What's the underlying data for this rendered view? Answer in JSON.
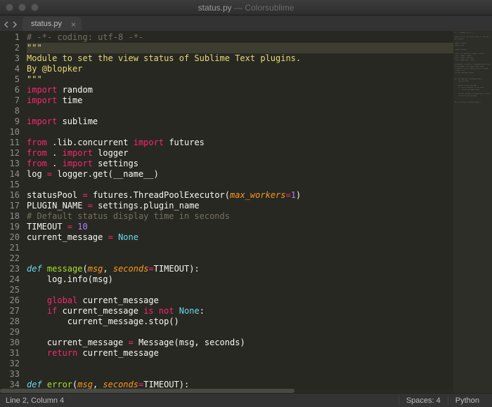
{
  "window": {
    "filename": "status.py",
    "app": "Colorsublime"
  },
  "tab": {
    "label": "status.py"
  },
  "statusbar": {
    "position": "Line 2, Column 4",
    "spaces": "Spaces: 4",
    "syntax": "Python"
  },
  "line_start": 1,
  "line_end": 34,
  "cursor_line": 2,
  "code": [
    {
      "t": [
        [
          "c-cmt",
          "# -*- coding: utf-8 -*-"
        ]
      ]
    },
    {
      "t": [
        [
          "c-str",
          "\"\"\""
        ]
      ]
    },
    {
      "t": [
        [
          "c-str",
          "Module to set the view status of Sublime Text plugins."
        ]
      ]
    },
    {
      "t": [
        [
          "c-str",
          "By @blopker"
        ]
      ]
    },
    {
      "t": [
        [
          "c-str",
          "\"\"\""
        ]
      ]
    },
    {
      "t": [
        [
          "c-kw",
          "import"
        ],
        [
          "",
          " random"
        ]
      ]
    },
    {
      "t": [
        [
          "c-kw",
          "import"
        ],
        [
          "",
          " time"
        ]
      ]
    },
    {
      "t": []
    },
    {
      "t": [
        [
          "c-kw",
          "import"
        ],
        [
          "",
          " sublime"
        ]
      ]
    },
    {
      "t": []
    },
    {
      "t": [
        [
          "c-kw",
          "from"
        ],
        [
          "",
          " .lib.concurrent "
        ],
        [
          "c-kw",
          "import"
        ],
        [
          "",
          " futures"
        ]
      ]
    },
    {
      "t": [
        [
          "c-kw",
          "from"
        ],
        [
          "",
          " . "
        ],
        [
          "c-kw",
          "import"
        ],
        [
          "",
          " logger"
        ]
      ]
    },
    {
      "t": [
        [
          "c-kw",
          "from"
        ],
        [
          "",
          " . "
        ],
        [
          "c-kw",
          "import"
        ],
        [
          "",
          " settings"
        ]
      ]
    },
    {
      "t": [
        [
          "",
          "log "
        ],
        [
          "c-op",
          "="
        ],
        [
          "",
          " logger.get(__name__)"
        ]
      ]
    },
    {
      "t": []
    },
    {
      "t": [
        [
          "",
          "statusPool "
        ],
        [
          "c-op",
          "="
        ],
        [
          "",
          " futures.ThreadPoolExecutor("
        ],
        [
          "c-arg",
          "max_workers"
        ],
        [
          "c-op",
          "="
        ],
        [
          "c-num",
          "1"
        ],
        [
          "",
          ")"
        ]
      ]
    },
    {
      "t": [
        [
          "",
          "PLUGIN_NAME "
        ],
        [
          "c-op",
          "="
        ],
        [
          "",
          " settings.plugin_name"
        ]
      ]
    },
    {
      "t": [
        [
          "c-cmt",
          "# Default status display time in seconds"
        ]
      ]
    },
    {
      "t": [
        [
          "",
          "TIMEOUT "
        ],
        [
          "c-op",
          "="
        ],
        [
          "",
          " "
        ],
        [
          "c-num",
          "10"
        ]
      ]
    },
    {
      "t": [
        [
          "",
          "current_message "
        ],
        [
          "c-op",
          "="
        ],
        [
          "",
          " "
        ],
        [
          "c-spc",
          "None"
        ]
      ]
    },
    {
      "t": []
    },
    {
      "t": []
    },
    {
      "t": [
        [
          "c-def",
          "def "
        ],
        [
          "c-fn",
          "message"
        ],
        [
          "",
          "("
        ],
        [
          "c-arg",
          "msg"
        ],
        [
          "",
          ", "
        ],
        [
          "c-arg",
          "seconds"
        ],
        [
          "c-op",
          "="
        ],
        [
          "",
          "TIMEOUT):"
        ]
      ]
    },
    {
      "t": [
        [
          "",
          "    log.info(msg)"
        ]
      ]
    },
    {
      "t": []
    },
    {
      "t": [
        [
          "",
          "    "
        ],
        [
          "c-kw",
          "global"
        ],
        [
          "",
          " current_message"
        ]
      ]
    },
    {
      "t": [
        [
          "",
          "    "
        ],
        [
          "c-kw",
          "if"
        ],
        [
          "",
          " current_message "
        ],
        [
          "c-kw",
          "is"
        ],
        [
          "",
          " "
        ],
        [
          "c-kw",
          "not"
        ],
        [
          "",
          " "
        ],
        [
          "c-spc",
          "None"
        ],
        [
          "",
          ":"
        ]
      ]
    },
    {
      "t": [
        [
          "",
          "        current_message.stop()"
        ]
      ]
    },
    {
      "t": []
    },
    {
      "t": [
        [
          "",
          "    current_message "
        ],
        [
          "c-op",
          "="
        ],
        [
          "",
          " Message(msg, seconds)"
        ]
      ]
    },
    {
      "t": [
        [
          "",
          "    "
        ],
        [
          "c-kw",
          "return"
        ],
        [
          "",
          " current_message"
        ]
      ]
    },
    {
      "t": []
    },
    {
      "t": []
    },
    {
      "t": [
        [
          "c-def",
          "def "
        ],
        [
          "c-fn",
          "error"
        ],
        [
          "",
          "("
        ],
        [
          "c-arg",
          "msg"
        ],
        [
          "",
          ", "
        ],
        [
          "c-arg",
          "seconds"
        ],
        [
          "c-op",
          "="
        ],
        [
          "",
          "TIMEOUT):"
        ]
      ]
    }
  ]
}
